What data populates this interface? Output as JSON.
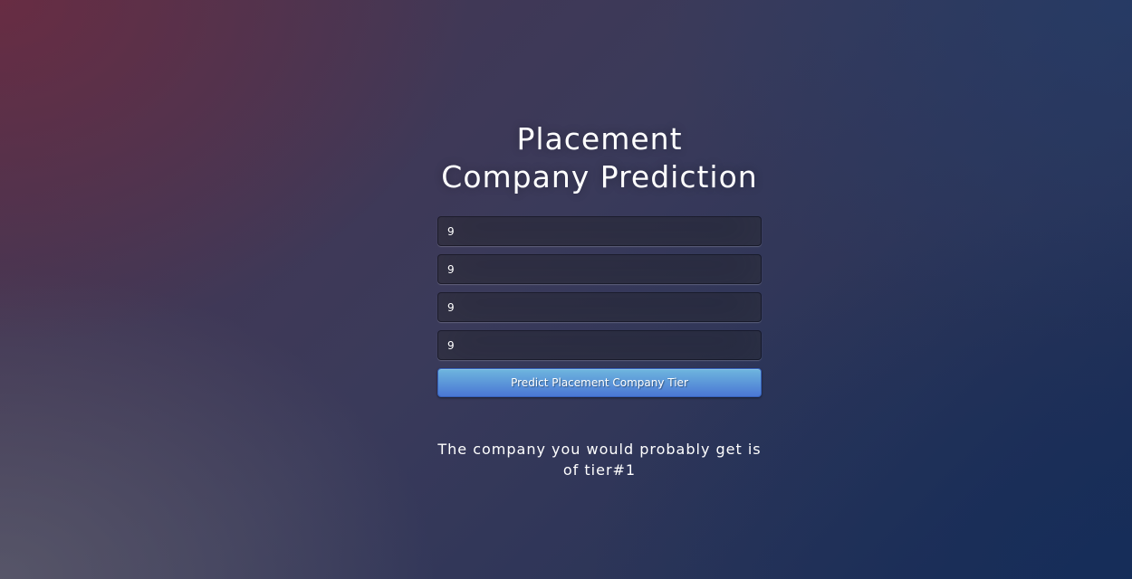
{
  "header": {
    "title": "Placement Company Prediction"
  },
  "form": {
    "fields": [
      {
        "value": "9"
      },
      {
        "value": "9"
      },
      {
        "value": "9"
      },
      {
        "value": "9"
      }
    ],
    "submit_label": "Predict Placement Company Tier"
  },
  "result": {
    "text": "The company you would probably get is of tier#1"
  }
}
